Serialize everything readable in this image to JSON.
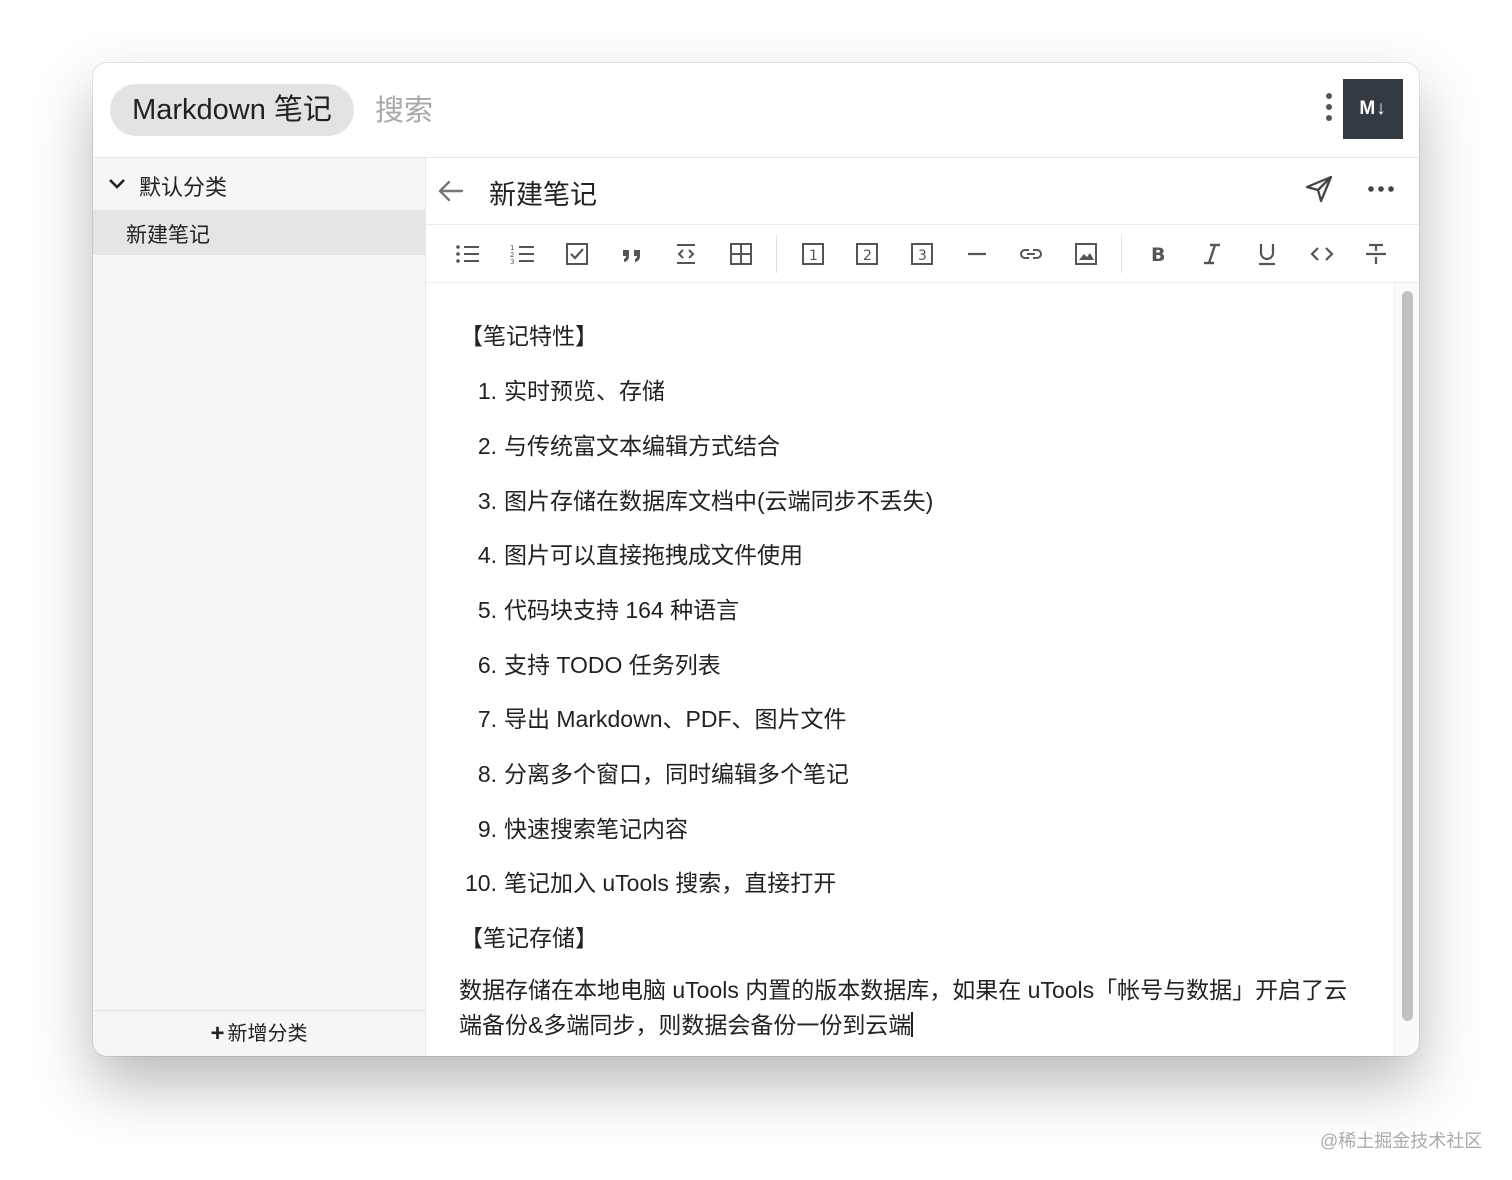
{
  "app": {
    "title": "Markdown 笔记",
    "logo_text": "M↓"
  },
  "search": {
    "placeholder": "搜索"
  },
  "sidebar": {
    "category": "默认分类",
    "notes": [
      "新建笔记"
    ],
    "add_category": "新增分类"
  },
  "note": {
    "title": "新建笔记",
    "section1": "【笔记特性】",
    "features": [
      {
        "num": "1.",
        "text": "实时预览、存储"
      },
      {
        "num": "2.",
        "text": "与传统富文本编辑方式结合"
      },
      {
        "num": "3.",
        "text": "图片存储在数据库文档中(云端同步不丢失)"
      },
      {
        "num": "4.",
        "text": "图片可以直接拖拽成文件使用"
      },
      {
        "num": "5.",
        "text": "代码块支持 164 种语言"
      },
      {
        "num": "6.",
        "text": "支持 TODO 任务列表"
      },
      {
        "num": "7.",
        "text": "导出 Markdown、PDF、图片文件"
      },
      {
        "num": "8.",
        "text": "分离多个窗口，同时编辑多个笔记"
      },
      {
        "num": "9.",
        "text": "快速搜索笔记内容"
      },
      {
        "num": "10.",
        "text": "笔记加入 uTools 搜索，直接打开"
      }
    ],
    "section2": "【笔记存储】",
    "storage_text": "数据存储在本地电脑 uTools 内置的版本数据库，如果在 uTools「帐号与数据」开启了云端备份&多端同步，则数据会备份一份到云端"
  },
  "toolbar_icons": [
    "bullet-list-icon",
    "ordered-list-icon",
    "task-list-icon",
    "quote-icon",
    "code-block-icon",
    "table-icon",
    "heading-1-icon",
    "heading-2-icon",
    "heading-3-icon",
    "horizontal-rule-icon",
    "link-icon",
    "image-icon",
    "bold-icon",
    "italic-icon",
    "underline-icon",
    "inline-code-icon",
    "strikethrough-icon"
  ],
  "watermark": "@稀土掘金技术社区",
  "colors": {
    "selected_bg": "#e5e5e5",
    "sidebar_bg": "#f6f6f6",
    "logo_bg": "#333a40"
  }
}
